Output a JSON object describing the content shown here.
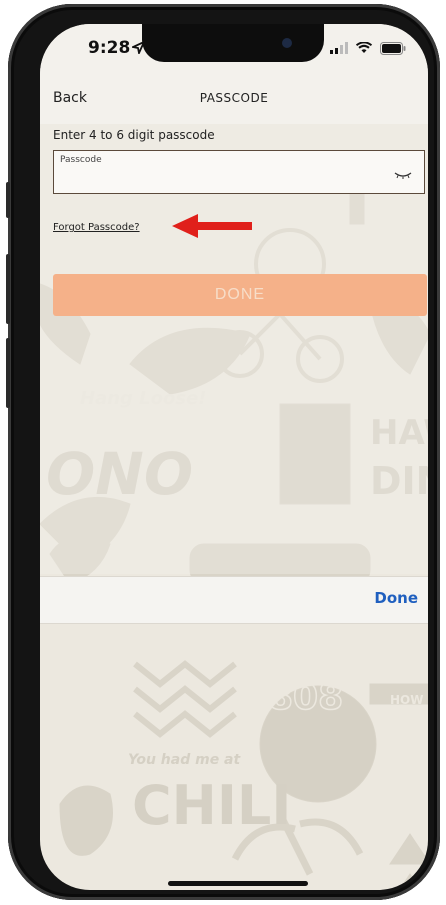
{
  "status_bar": {
    "time": "9:28"
  },
  "nav": {
    "back_label": "Back",
    "title": "PASSCODE"
  },
  "form": {
    "instruction": "Enter 4 to 6 digit passcode",
    "passcode_placeholder": "Passcode",
    "forgot_label": "Forgot Passcode?",
    "done_label": "DONE"
  },
  "keyboard_bar": {
    "done_label": "Done"
  },
  "background_texts": {
    "hang_loose": "Hang Loose!",
    "ono": "ONO",
    "hawaiian_1": "HAWA",
    "hawaiian_2": "DIN",
    "number": "808",
    "you_had_me": "You had me at",
    "chili": "CHILI",
    "how": "HOW"
  },
  "colors": {
    "background": "#ece8df",
    "done_button": "#f5b189",
    "accent_blue": "#1f5fbf",
    "arrow_red": "#e0201b",
    "field_border": "#5b4a3b"
  },
  "icons": [
    "location-arrow-icon",
    "signal-icon",
    "wifi-icon",
    "battery-icon",
    "eye-closed-icon",
    "red-arrow-icon"
  ]
}
